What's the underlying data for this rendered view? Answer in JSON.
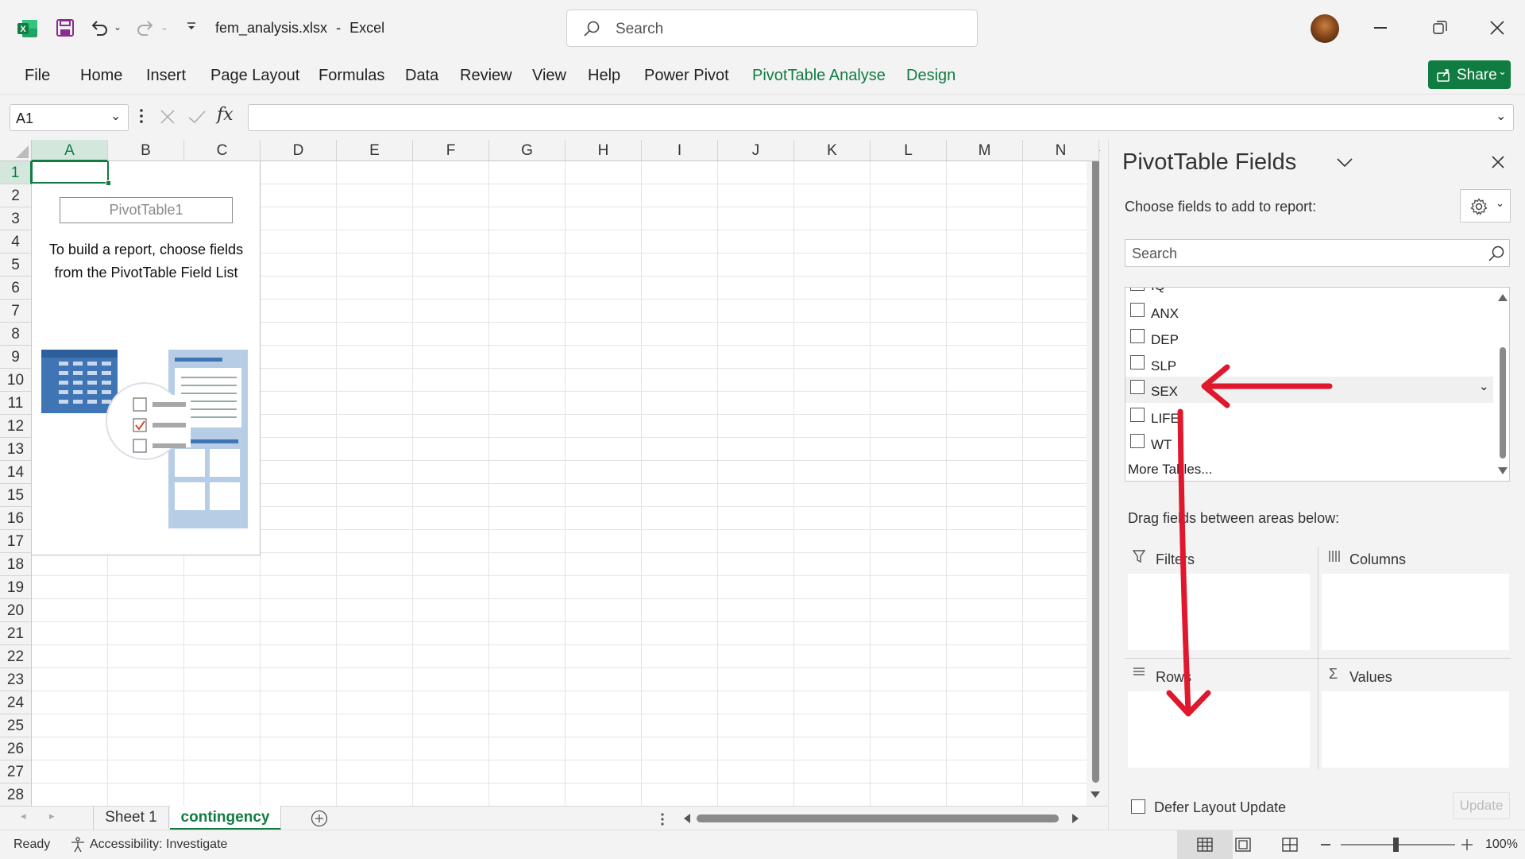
{
  "titlebar": {
    "filename": "fem_analysis.xlsx",
    "separator": "-",
    "app_name": "Excel",
    "search_placeholder": "Search"
  },
  "ribbon_tabs": [
    "File",
    "Home",
    "Insert",
    "Page Layout",
    "Formulas",
    "Data",
    "Review",
    "View",
    "Help",
    "Power Pivot",
    "PivotTable Analyse",
    "Design"
  ],
  "share_label": "Share",
  "formula_bar": {
    "name_box": "A1",
    "fx": "fx",
    "formula": ""
  },
  "columns": [
    "A",
    "B",
    "C",
    "D",
    "E",
    "F",
    "G",
    "H",
    "I",
    "J",
    "K",
    "L",
    "M",
    "N"
  ],
  "rows": [
    "1",
    "2",
    "3",
    "4",
    "5",
    "6",
    "7",
    "8",
    "9",
    "10",
    "11",
    "12",
    "13",
    "14",
    "15",
    "16",
    "17",
    "18",
    "19",
    "20",
    "21",
    "22",
    "23",
    "24",
    "25",
    "26",
    "27",
    "28"
  ],
  "pivot_placeholder": {
    "name": "PivotTable1",
    "line1": "To build a report, choose fields",
    "line2": "from the PivotTable Field List"
  },
  "sheet_tabs": [
    {
      "label": "Sheet 1",
      "active": false
    },
    {
      "label": "contingency",
      "active": true
    }
  ],
  "status": {
    "ready": "Ready",
    "accessibility": "Accessibility: Investigate",
    "zoom": "100%"
  },
  "pivot_panel": {
    "title": "PivotTable Fields",
    "choose_label": "Choose fields to add to report:",
    "search_placeholder": "Search",
    "partial_field": "IQ",
    "fields": [
      "ANX",
      "DEP",
      "SLP",
      "SEX",
      "LIFE",
      "WT"
    ],
    "more_tables": "More Tables...",
    "drag_label": "Drag fields between areas below:",
    "areas": {
      "filters": "Filters",
      "columns": "Columns",
      "rows": "Rows",
      "values": "Values"
    },
    "defer_label": "Defer Layout Update",
    "update_label": "Update"
  },
  "colors": {
    "excel_green": "#107c41",
    "annotation_red": "#e0182e"
  }
}
